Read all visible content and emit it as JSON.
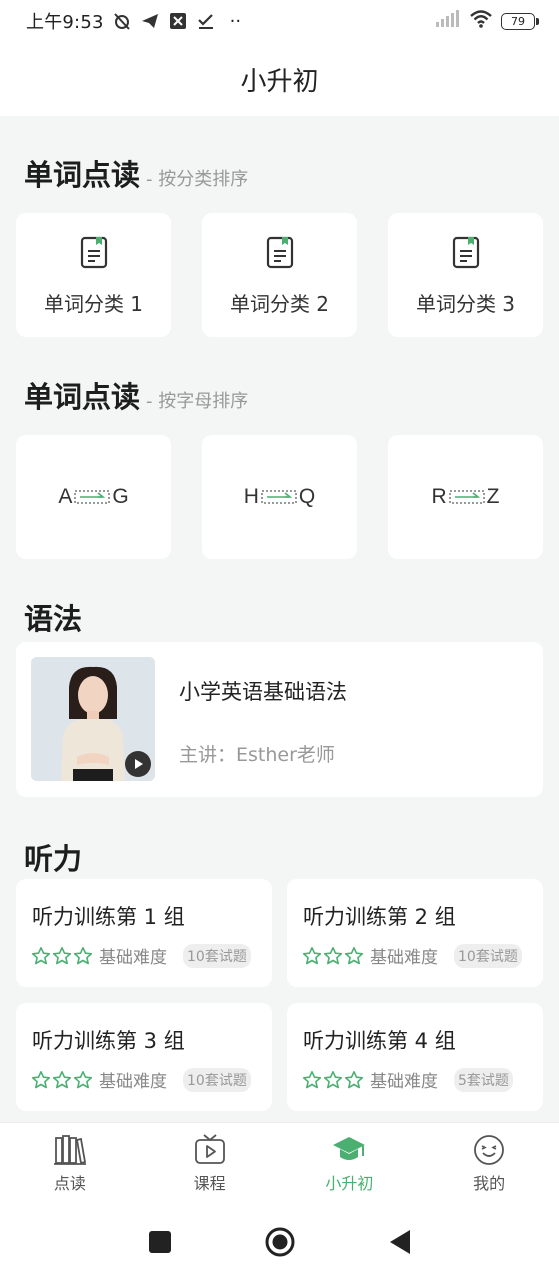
{
  "status_bar": {
    "time": "上午9:53",
    "dots": "··",
    "battery": "79"
  },
  "header": {
    "title": "小升初"
  },
  "sections": {
    "word_category": {
      "title": "单词点读",
      "subtitle": "- 按分类排序",
      "tiles": [
        {
          "label": "单词分类 1"
        },
        {
          "label": "单词分类 2"
        },
        {
          "label": "单词分类 3"
        }
      ]
    },
    "word_alpha": {
      "title": "单词点读",
      "subtitle": "- 按字母排序",
      "ranges": [
        {
          "from": "A",
          "to": "G"
        },
        {
          "from": "H",
          "to": "Q"
        },
        {
          "from": "R",
          "to": "Z"
        }
      ]
    },
    "grammar": {
      "title": "语法",
      "course": {
        "title": "小学英语基础语法",
        "teacher": "主讲：Esther老师"
      }
    },
    "listening": {
      "title": "听力",
      "cards": [
        {
          "title": "听力训练第 1 组",
          "difficulty": "基础难度",
          "badge": "10套试题"
        },
        {
          "title": "听力训练第 2 组",
          "difficulty": "基础难度",
          "badge": "10套试题"
        },
        {
          "title": "听力训练第 3 组",
          "difficulty": "基础难度",
          "badge": "10套试题"
        },
        {
          "title": "听力训练第 4 组",
          "difficulty": "基础难度",
          "badge": "5套试题"
        }
      ]
    }
  },
  "tabbar": {
    "items": [
      {
        "label": "点读",
        "icon": "books-icon"
      },
      {
        "label": "课程",
        "icon": "tv-play-icon"
      },
      {
        "label": "小升初",
        "icon": "graduation-cap-icon",
        "active": true
      },
      {
        "label": "我的",
        "icon": "smiley-face-icon"
      }
    ]
  },
  "colors": {
    "accent": "#4caf72",
    "background": "#f4f5f5"
  }
}
